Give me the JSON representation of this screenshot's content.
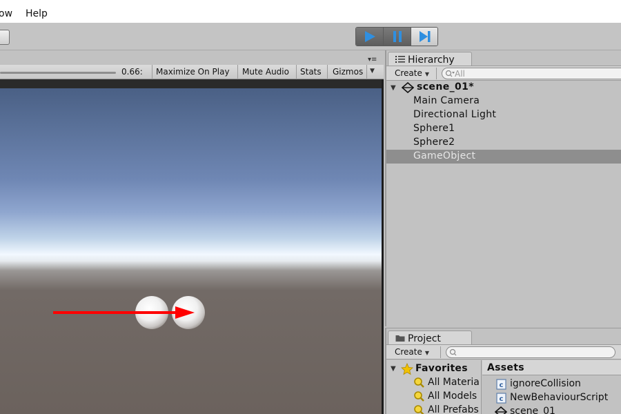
{
  "menu": {
    "items": [
      "ow",
      "Help"
    ]
  },
  "toolbar": {
    "play": "play-icon",
    "pause": "pause-icon",
    "step": "step-icon"
  },
  "game": {
    "scale_value": "0.66:",
    "maximize_on_play": "Maximize On Play",
    "mute_audio": "Mute Audio",
    "stats": "Stats",
    "gizmos": "Gizmos"
  },
  "hierarchy": {
    "tab_label": "Hierarchy",
    "create_label": "Create",
    "search_placeholder": "All",
    "scene": "scene_01*",
    "items": [
      "Main Camera",
      "Directional Light",
      "Sphere1",
      "Sphere2",
      "GameObject"
    ],
    "selected_index": 4
  },
  "project": {
    "tab_label": "Project",
    "create_label": "Create",
    "favorites_label": "Favorites",
    "favorites": [
      "All Materia",
      "All Models",
      "All Prefabs"
    ],
    "assets_label": "Assets",
    "assets": [
      "ignoreCollision",
      "NewBehaviourScript",
      "scene_01"
    ]
  },
  "colors": {
    "play_accent": "#2f8fe0",
    "arrow": "#ff0000",
    "selected_row": "#8e8e8e"
  }
}
